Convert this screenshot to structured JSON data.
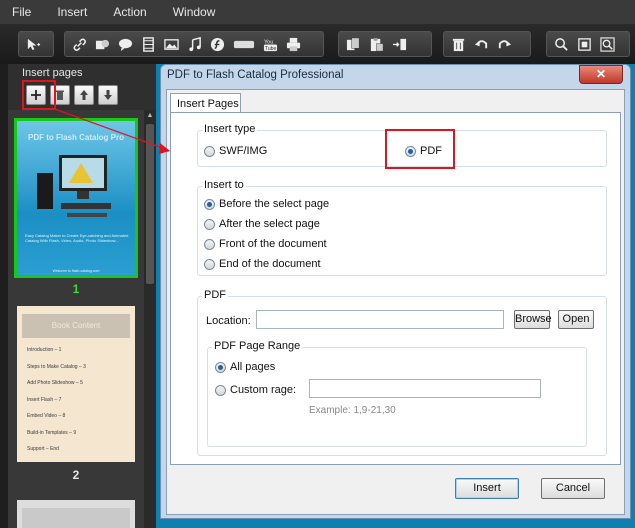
{
  "menubar": {
    "items": [
      "File",
      "Insert",
      "Action",
      "Window"
    ]
  },
  "toolbar": {
    "icons": [
      "select-arrow-icon",
      "link-icon",
      "shape-icon",
      "speech-bubble-icon",
      "film-icon",
      "image-icon",
      "music-icon",
      "flash-icon",
      "button-icon",
      "youtube-icon",
      "print-icon",
      "copy-icon",
      "paste-icon",
      "swap-icon",
      "trash-icon",
      "undo-icon",
      "redo-icon",
      "zoom-in-icon",
      "fit-icon",
      "zoom-out-icon"
    ]
  },
  "left_panel": {
    "title": "Insert pages",
    "tools": [
      "add-page-icon",
      "delete-page-icon",
      "move-up-icon",
      "move-down-icon"
    ],
    "pages": [
      {
        "number": "1",
        "title": "PDF to Flash Catalog Pro",
        "text": "Easy Catalog Maker to Create Eye-catching and Animated Catalog With Flash, Video, Audio, Photo Slideshow...",
        "footer": "Welcome to flash-catalog.com"
      },
      {
        "number": "2",
        "title": "Book Content",
        "items": [
          "Introduction – 1",
          "Steps to Make Catalog – 3",
          "Add Photo Slideshow – 5",
          "Insert Flash – 7",
          "Embed Video – 8",
          "Build-in Templates – 9",
          "Support – End"
        ]
      }
    ]
  },
  "dialog": {
    "title": "PDF to Flash Catalog Professional",
    "close_label": "✕",
    "tab_label": "Insert Pages",
    "insert_type": {
      "label": "Insert type",
      "options": [
        {
          "label": "SWF/IMG",
          "checked": false
        },
        {
          "label": "PDF",
          "checked": true
        }
      ]
    },
    "insert_to": {
      "label": "Insert to",
      "options": [
        {
          "label": "Before the select page",
          "checked": true
        },
        {
          "label": "After the select page",
          "checked": false
        },
        {
          "label": "Front of the document",
          "checked": false
        },
        {
          "label": "End of the document",
          "checked": false
        }
      ]
    },
    "pdf": {
      "label": "PDF",
      "location_label": "Location:",
      "location_value": "",
      "browse_label": "Browse",
      "open_label": "Open",
      "range": {
        "label": "PDF Page Range",
        "all_pages_label": "All pages",
        "all_pages_checked": true,
        "custom_label": "Custom rage:",
        "custom_checked": false,
        "custom_value": "",
        "example": "Example: 1,9-21,30"
      }
    },
    "insert_label": "Insert",
    "cancel_label": "Cancel"
  },
  "colors": {
    "highlight_red": "#e0141e",
    "selected_page_green": "#17c817",
    "dialog_frame": "#c4d6ea"
  }
}
